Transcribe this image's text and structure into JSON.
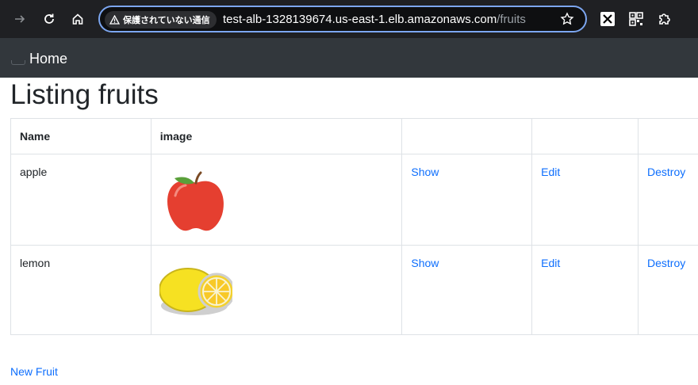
{
  "browser": {
    "security_label": "保護されていない通信",
    "url_host": "test-alb-1328139674.us-east-1.elb.amazonaws.com",
    "url_path": "/fruits"
  },
  "navbar": {
    "brand": "Home"
  },
  "page": {
    "title": "Listing fruits",
    "new_link": "New Fruit"
  },
  "table": {
    "headers": [
      "Name",
      "image",
      "",
      "",
      ""
    ],
    "rows": [
      {
        "name": "apple",
        "image_icon": "apple-icon",
        "show": "Show",
        "edit": "Edit",
        "destroy": "Destroy"
      },
      {
        "name": "lemon",
        "image_icon": "lemon-icon",
        "show": "Show",
        "edit": "Edit",
        "destroy": "Destroy"
      }
    ]
  },
  "colors": {
    "link": "#0d6efd",
    "navbar": "#32373c",
    "chrome": "#1f2023",
    "omnibox_border": "#7ca6f0"
  }
}
